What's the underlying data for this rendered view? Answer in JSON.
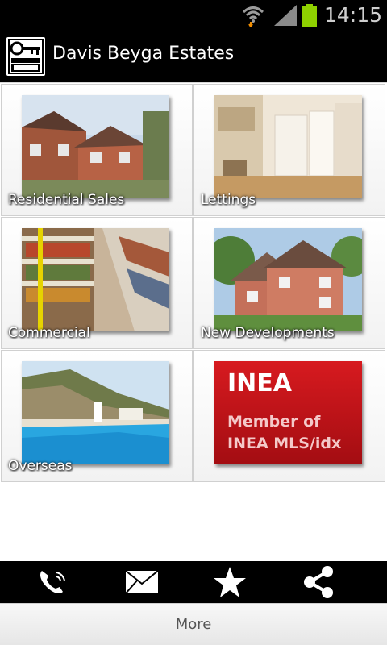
{
  "status_bar": {
    "time": "14:15",
    "battery_color": "#8fd100"
  },
  "app": {
    "title": "Davis Beyga Estates",
    "logo_icon": "key-logo-icon"
  },
  "tiles": [
    {
      "label": "Residential Sales",
      "icon": "house-photo"
    },
    {
      "label": "Lettings",
      "icon": "kitchen-photo"
    },
    {
      "label": "Commercial",
      "icon": "shop-shelves-photo"
    },
    {
      "label": "New Developments",
      "icon": "new-house-photo"
    },
    {
      "label": "Overseas",
      "icon": "pool-photo"
    },
    {
      "label": "INEA",
      "sublabel_1": "Member of",
      "sublabel_2": "INEA MLS/idx",
      "color": "#c8141a"
    }
  ],
  "toolbar": {
    "items": [
      "phone-icon",
      "mail-icon",
      "star-icon",
      "share-icon"
    ]
  },
  "more": {
    "label": "More"
  }
}
